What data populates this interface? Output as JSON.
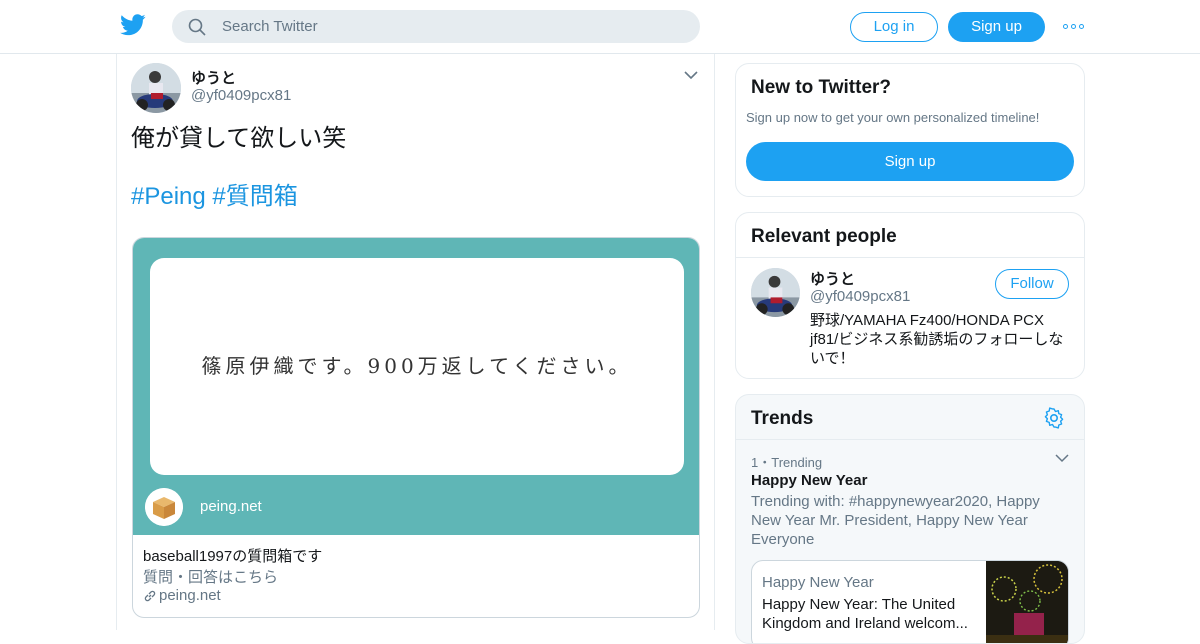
{
  "header": {
    "search_placeholder": "Search Twitter",
    "login_label": "Log in",
    "signup_label": "Sign up",
    "brand_color": "#1da1f2"
  },
  "tweet": {
    "author_name": "ゆうと",
    "author_handle": "@yf0409pcx81",
    "text": "俺が貸して欲しい笑",
    "hashtags": [
      "#Peing",
      "#質問箱"
    ],
    "card": {
      "question_text": "篠原伊織です。900万返してください。",
      "site_badge": "peing.net",
      "title": "baseball1997の質問箱です",
      "description": "質問・回答はこちら",
      "link": "peing.net",
      "image_bg_color": "#5fb6b6"
    }
  },
  "sidebar": {
    "new_to_twitter": {
      "title": "New to Twitter?",
      "subtitle": "Sign up now to get your own personalized timeline!",
      "button_label": "Sign up"
    },
    "relevant_people": {
      "title": "Relevant people",
      "person": {
        "name": "ゆうと",
        "handle": "@yf0409pcx81",
        "follow_label": "Follow",
        "bio": "野球/YAMAHA Fz400/HONDA PCX jf81/ビジネス系勧誘垢のフォローしないで！"
      }
    },
    "trends": {
      "title": "Trends",
      "items": [
        {
          "meta": "1・Trending",
          "name": "Happy New Year",
          "trending_with": "Trending with: #happynewyear2020, Happy New Year Mr. President, Happy New Year Everyone",
          "card_label": "Happy New Year",
          "card_headline": "Happy New Year: The United Kingdom and Ireland welcom..."
        }
      ]
    }
  }
}
